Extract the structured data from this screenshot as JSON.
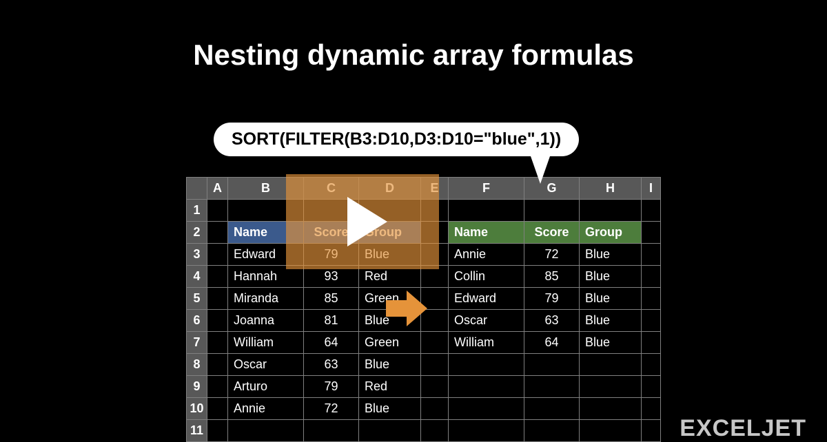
{
  "title": "Nesting dynamic array formulas",
  "formula": "SORT(FILTER(B3:D10,D3:D10=\"blue\",1))",
  "columns": [
    "A",
    "B",
    "C",
    "D",
    "E",
    "F",
    "G",
    "H",
    "I"
  ],
  "row_numbers": [
    "1",
    "2",
    "3",
    "4",
    "5",
    "6",
    "7",
    "8",
    "9",
    "10",
    "11"
  ],
  "left_headers": {
    "name": "Name",
    "score": "Score",
    "group": "Group"
  },
  "right_headers": {
    "name": "Name",
    "score": "Score",
    "group": "Group"
  },
  "left_data": [
    {
      "name": "Edward",
      "score": "79",
      "group": "Blue"
    },
    {
      "name": "Hannah",
      "score": "93",
      "group": "Red"
    },
    {
      "name": "Miranda",
      "score": "85",
      "group": "Green"
    },
    {
      "name": "Joanna",
      "score": "81",
      "group": "Blue"
    },
    {
      "name": "William",
      "score": "64",
      "group": "Green"
    },
    {
      "name": "Oscar",
      "score": "63",
      "group": "Blue"
    },
    {
      "name": "Arturo",
      "score": "79",
      "group": "Red"
    },
    {
      "name": "Annie",
      "score": "72",
      "group": "Blue"
    }
  ],
  "right_data": [
    {
      "name": "Annie",
      "score": "72",
      "group": "Blue"
    },
    {
      "name": "Collin",
      "score": "85",
      "group": "Blue"
    },
    {
      "name": "Edward",
      "score": "79",
      "group": "Blue"
    },
    {
      "name": "Oscar",
      "score": "63",
      "group": "Blue"
    },
    {
      "name": "William",
      "score": "64",
      "group": "Blue"
    }
  ],
  "logo": "EXCELJET"
}
